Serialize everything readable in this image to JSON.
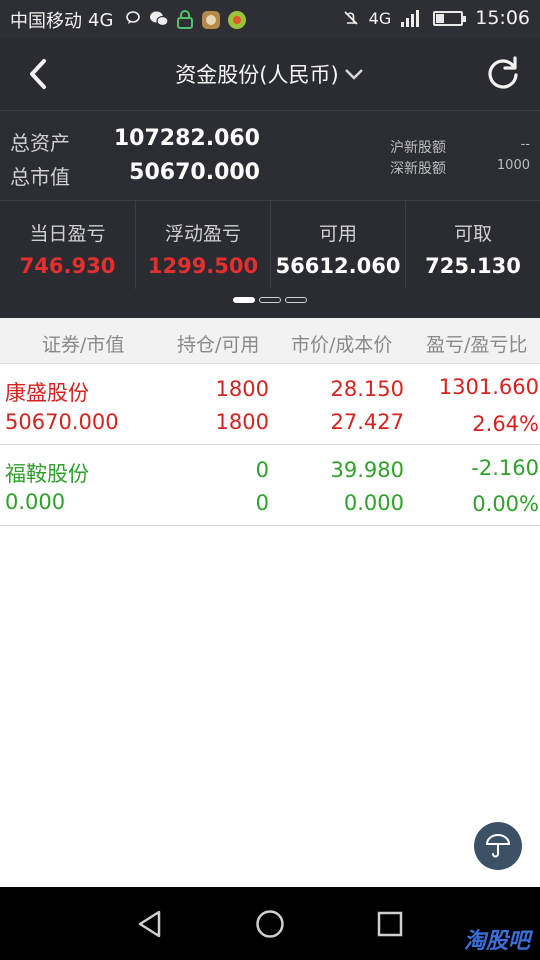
{
  "status_bar": {
    "carrier": "中国移动",
    "network": "4G",
    "right_network": "4G",
    "battery_level": 0.35,
    "time": "15:06",
    "icons": [
      "chat-bubble-icon",
      "wechat-icon",
      "lock-app-icon",
      "game-app-icon",
      "app-icon",
      "mute-icon",
      "signal-icon",
      "battery-icon"
    ]
  },
  "header": {
    "title": "资金股份(人民币)"
  },
  "summary": {
    "total_assets_label": "总资产",
    "total_assets_value": "107282.060",
    "market_value_label": "总市值",
    "market_value_value": "50670.000",
    "sh_new_label": "沪新股额",
    "sh_new_value": "--",
    "sz_new_label": "深新股额",
    "sz_new_value": "1000"
  },
  "metrics": [
    {
      "label": "当日盈亏",
      "value": "746.930",
      "color": "#e3302f"
    },
    {
      "label": "浮动盈亏",
      "value": "1299.500",
      "color": "#e3302f"
    },
    {
      "label": "可用",
      "value": "56612.060",
      "color": "#ffffff"
    },
    {
      "label": "可取",
      "value": "725.130",
      "color": "#ffffff"
    }
  ],
  "pager": {
    "count": 3,
    "active": 0
  },
  "table": {
    "headers": [
      "证券/市值",
      "持仓/可用",
      "市价/成本价",
      "盈亏/盈亏比"
    ],
    "rows": [
      {
        "name": "康盛股份",
        "market_value": "50670.000",
        "position": "1800",
        "available": "1800",
        "price": "28.150",
        "cost": "27.427",
        "pnl": "1301.660",
        "pnl_ratio": "2.64%",
        "color": "#d6231f"
      },
      {
        "name": "福鞍股份",
        "market_value": "0.000",
        "position": "0",
        "available": "0",
        "price": "39.980",
        "cost": "0.000",
        "pnl": "-2.160",
        "pnl_ratio": "0.00%",
        "color": "#2ea22b"
      }
    ]
  },
  "watermark": "淘股吧"
}
